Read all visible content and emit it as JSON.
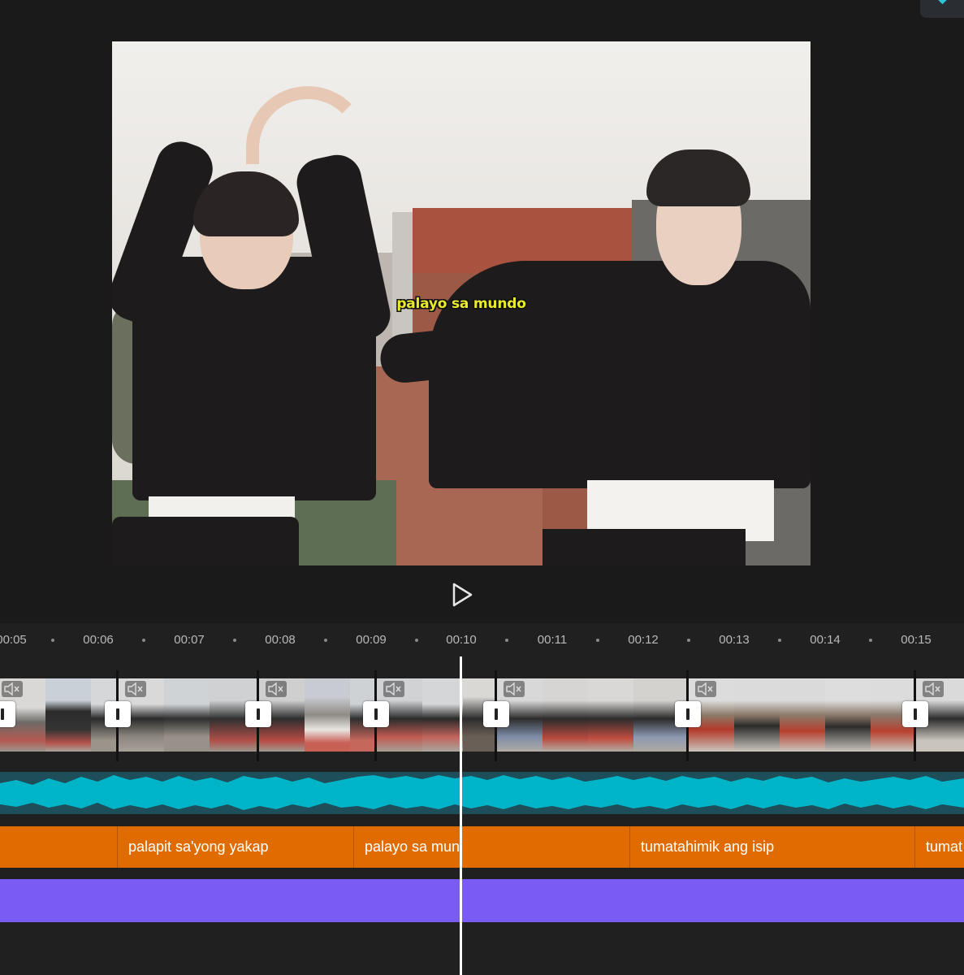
{
  "preview": {
    "caption": "palayo sa mundo"
  },
  "controls": {
    "play_icon": "play-icon"
  },
  "ruler": {
    "labels": [
      "00:05",
      "00:06",
      "00:07",
      "00:08",
      "00:09",
      "00:10",
      "00:11",
      "00:12",
      "00:13",
      "00:14",
      "00:15"
    ]
  },
  "captions": {
    "segments": [
      "",
      "palapit sa'yong yakap",
      "palayo sa mundo",
      "",
      "tumatahimik ang isip",
      "tumat"
    ]
  },
  "colors": {
    "caption_text": "#e9ea2e",
    "audio_wave": "#00b4c8",
    "caption_track": "#e06b00",
    "purple_track": "#7a5cf5",
    "accent": "#2ec4d8"
  }
}
